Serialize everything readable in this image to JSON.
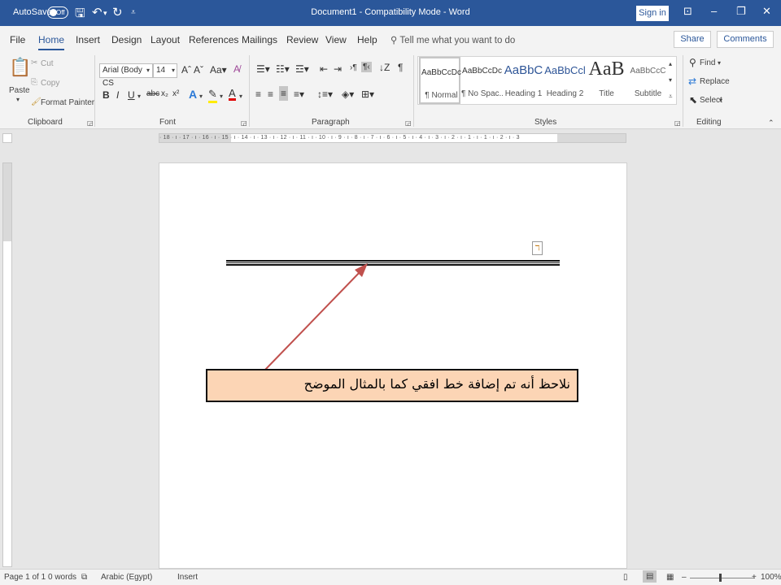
{
  "titlebar": {
    "autosave_label": "AutoSave",
    "autosave_state": "Off",
    "title": "Document1  -  Compatibility Mode  -  Word",
    "signin": "Sign in"
  },
  "tabs": [
    "File",
    "Home",
    "Insert",
    "Design",
    "Layout",
    "References",
    "Mailings",
    "Review",
    "View",
    "Help"
  ],
  "tellme": "Tell me what you want to do",
  "share": "Share",
  "comments": "Comments",
  "clipboard": {
    "paste": "Paste",
    "cut": "Cut",
    "copy": "Copy",
    "format_painter": "Format Painter",
    "label": "Clipboard"
  },
  "font": {
    "name": "Arial (Body CS",
    "size": "14",
    "label": "Font"
  },
  "paragraph": {
    "label": "Paragraph"
  },
  "styles": {
    "items": [
      {
        "sample": "AaBbCcDc",
        "name": "¶ Normal"
      },
      {
        "sample": "AaBbCcDc",
        "name": "¶ No Spac..."
      },
      {
        "sample": "AaBbC",
        "name": "Heading 1"
      },
      {
        "sample": "AaBbCcl",
        "name": "Heading 2"
      },
      {
        "sample": "AaB",
        "name": "Title"
      },
      {
        "sample": "AaBbCcC",
        "name": "Subtitle"
      }
    ],
    "label": "Styles"
  },
  "editing": {
    "find": "Find",
    "replace": "Replace",
    "select": "Select",
    "label": "Editing"
  },
  "ruler_text": "· 18 · ı · 17 · ı · 16 · ı · 15 · ı · 14 · ı · 13 · ı · 12 · ı · 11 · ı · 10 · ı · 9 · ı · 8 · ı · 7 · ı · 6 · ı · 5 · ı · 4 · ı · 3 · ı · 2 · ı · 1 · ı · 1 · ı · 2 · ı · 3",
  "document": {
    "callout_text": "نلاحظ أنه تم إضافة خط افقي كما بالمثال الموضح"
  },
  "status": {
    "page": "Page 1 of 1",
    "words": "0 words",
    "language": "Arabic (Egypt)",
    "mode": "Insert",
    "zoom": "100%"
  },
  "colors": {
    "brand": "#2b579a",
    "callout_fill": "#fcd5b5",
    "arrow": "#c0504d"
  }
}
